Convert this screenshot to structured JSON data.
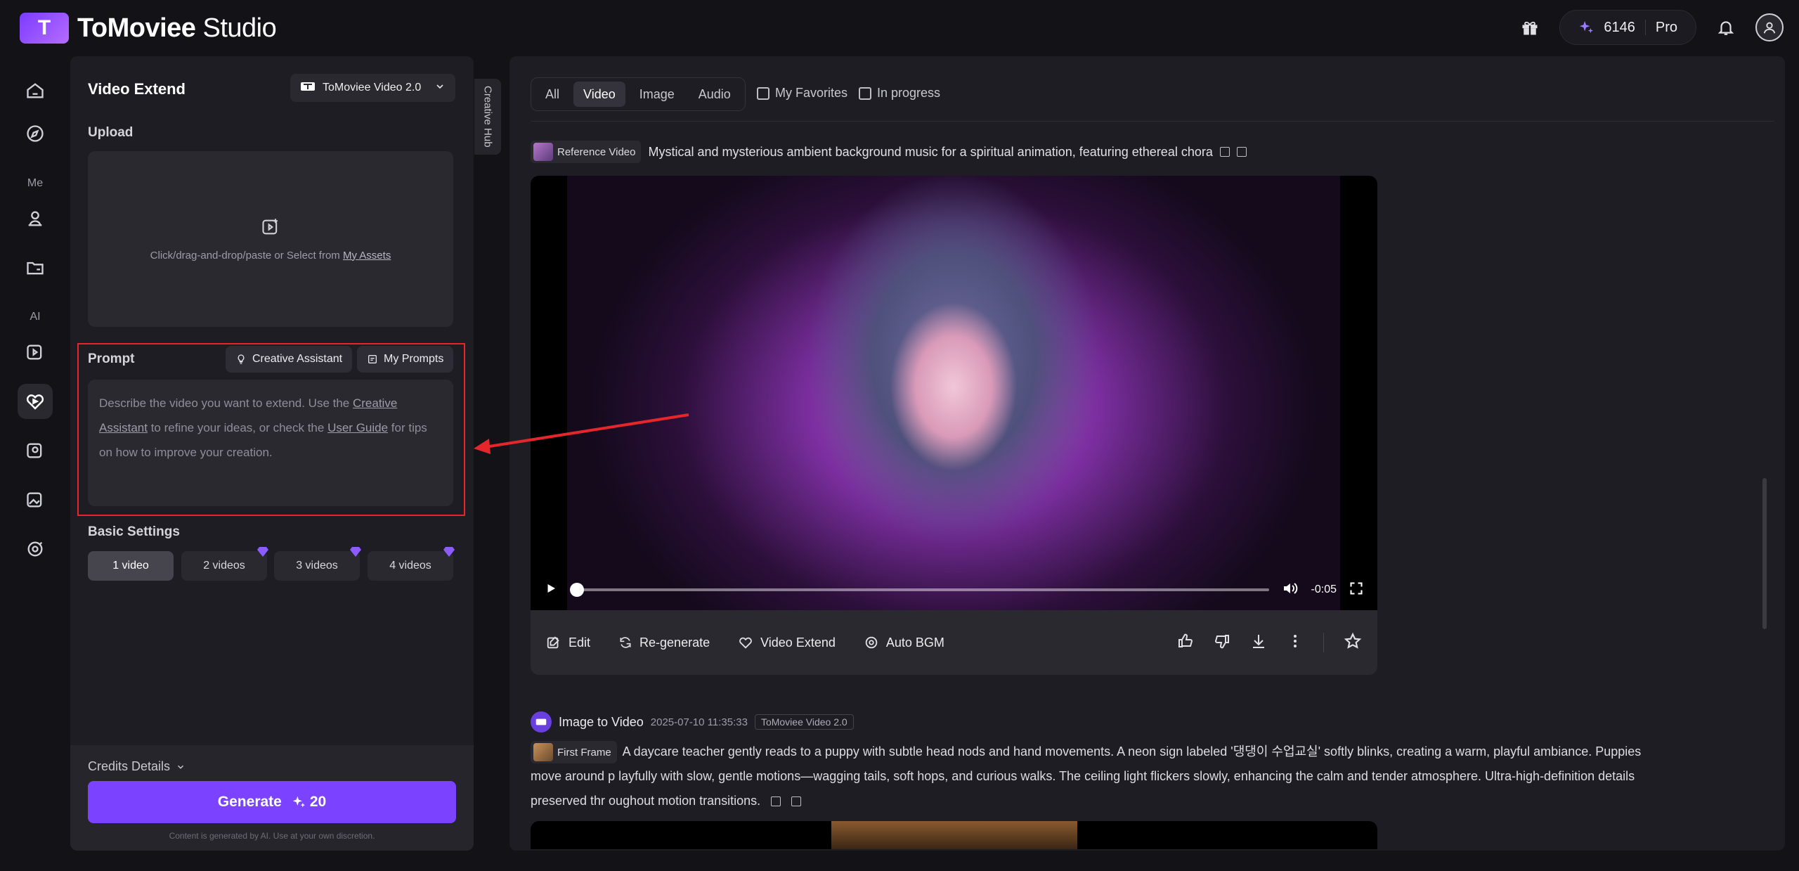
{
  "brand": {
    "name_bold": "ToMoviee",
    "name_light": "Studio",
    "logo_glyph": "T"
  },
  "topbar": {
    "credits": "6146",
    "plan": "Pro"
  },
  "leftnav": {
    "section_me": "Me",
    "section_ai": "AI"
  },
  "panel": {
    "title": "Video Extend",
    "model": "ToMoviee Video 2.0",
    "upload_label": "Upload",
    "upload_hint": "Click/drag-and-drop/paste or Select from ",
    "upload_link": "My Assets",
    "prompt_label": "Prompt",
    "creative_assistant": "Creative Assistant",
    "my_prompts": "My Prompts",
    "prompt_placeholder": {
      "t1": "Describe the video you want to extend. Use the ",
      "link1": "Creative Assistant",
      "t2": " to refine your ideas, or check the ",
      "link2": "User Guide",
      "t3": " for tips on how to improve your creation."
    },
    "basic_settings": "Basic Settings",
    "video_counts": [
      "1 video",
      "2 videos",
      "3 videos",
      "4 videos"
    ],
    "credits_details": "Credits Details",
    "generate": "Generate",
    "generate_cost": "20",
    "disclaimer": "Content is generated by AI. Use at your own discretion."
  },
  "hub_tab": "Creative Hub",
  "filters": {
    "tabs": [
      "All",
      "Video",
      "Image",
      "Audio"
    ],
    "active_tab": "Video",
    "my_favorites": "My Favorites",
    "in_progress": "In progress"
  },
  "item1": {
    "chip": "Reference Video",
    "prompt": "Mystical and mysterious ambient background music for a spiritual animation, featuring ethereal chora",
    "time": "-0:05",
    "progress": 0,
    "actions": [
      "Edit",
      "Re-generate",
      "Video Extend",
      "Auto BGM"
    ]
  },
  "item2": {
    "type": "Image to Video",
    "timestamp": "2025-07-10 11:35:33",
    "model": "ToMoviee Video 2.0",
    "chip": "First Frame",
    "prompt": "A daycare teacher gently reads to a puppy with subtle head nods and hand movements. A neon sign labeled '댕댕이 수업교실' softly blinks, creating a warm, playful ambiance. Puppies move around p layfully with slow, gentle motions—wagging tails, soft hops, and curious walks. The ceiling light flickers slowly, enhancing the calm and tender atmosphere. Ultra-high-definition details preserved thr oughout motion transitions."
  },
  "colors": {
    "accent": "#7b43ff",
    "annotation": "#e5262b",
    "gem": "#8b5cff"
  }
}
